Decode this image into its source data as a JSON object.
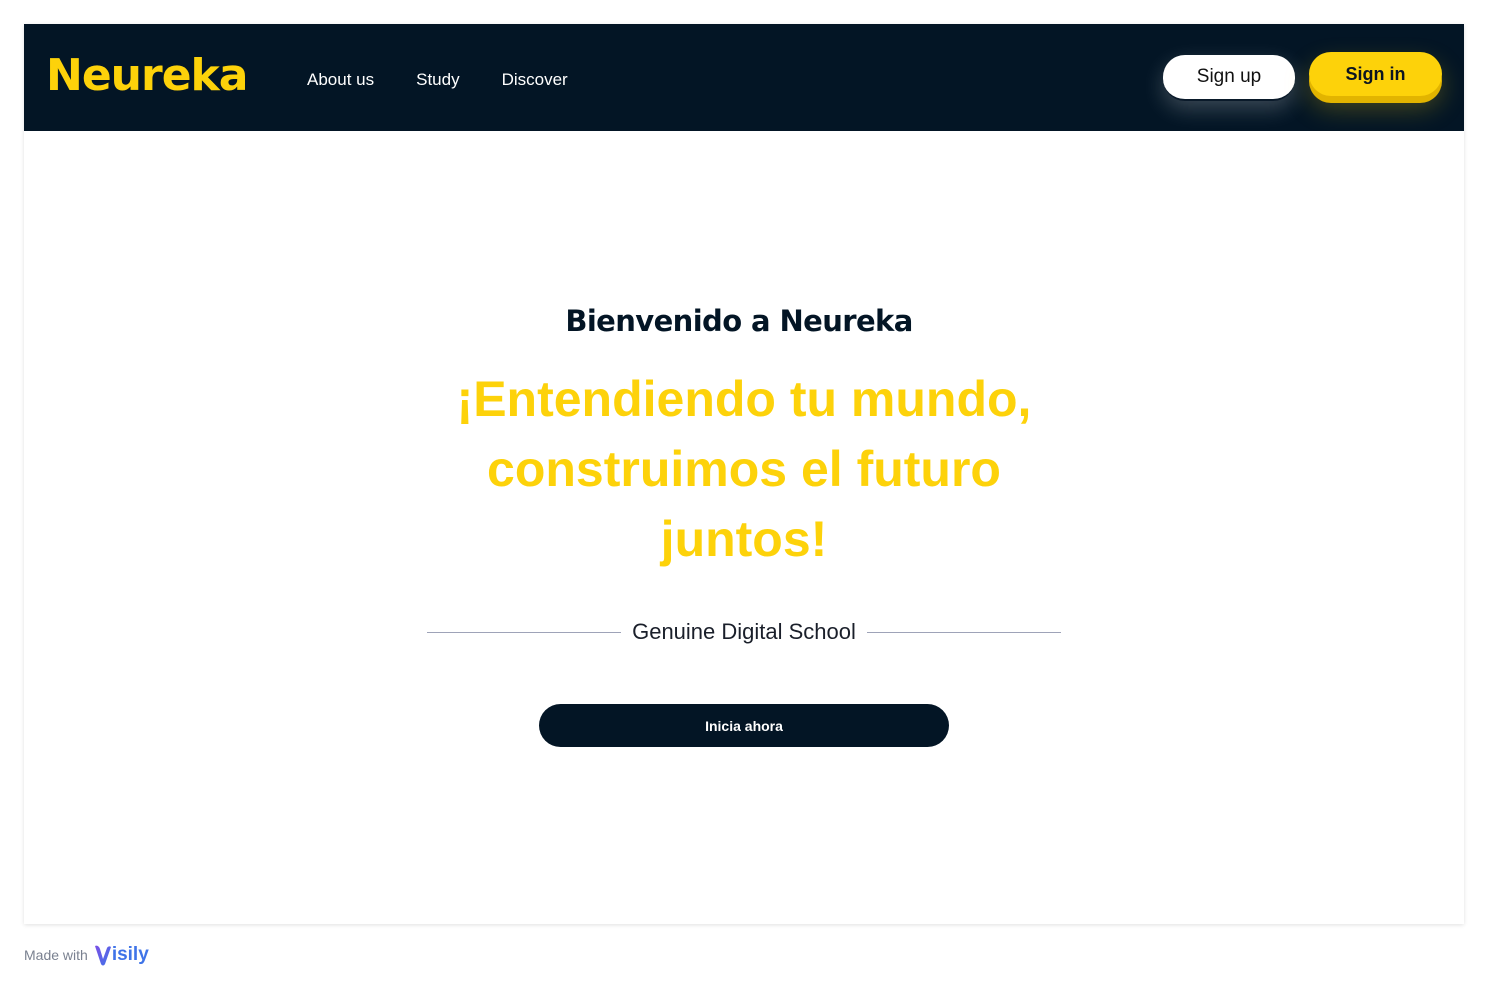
{
  "brand": {
    "logo_text": "Neureka",
    "logo_color": "#fdd20a",
    "nav_bg": "#031525"
  },
  "nav": {
    "links": [
      {
        "label": "About us"
      },
      {
        "label": "Study"
      },
      {
        "label": "Discover"
      }
    ],
    "signup_label": "Sign up",
    "signin_label": "Sign in"
  },
  "hero": {
    "welcome": "Bienvenido a Neureka",
    "headline_lines": [
      "¡Entendiendo tu mundo,",
      "construimos el futuro",
      "juntos!"
    ],
    "tagline": "Genuine Digital School",
    "cta_label": "Inicia ahora"
  },
  "footer": {
    "made_with": "Made with",
    "badge_brand": "isily",
    "badge_icon": "visily-v-icon"
  }
}
